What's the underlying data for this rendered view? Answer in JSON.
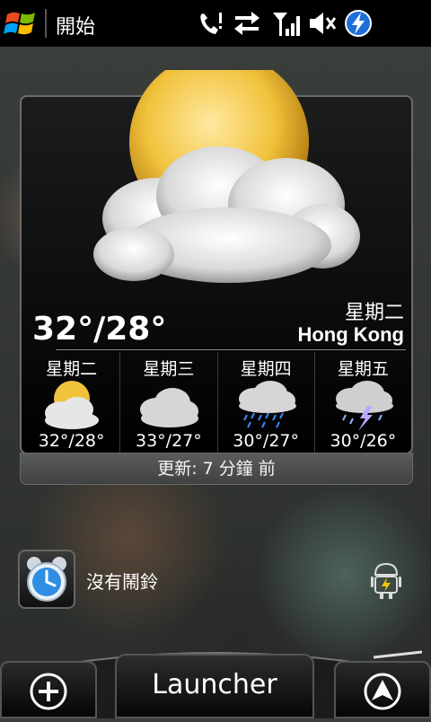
{
  "status_bar": {
    "title": "開始",
    "icons": [
      "windows-start-icon",
      "missed-call-icon",
      "data-transfer-icon",
      "signal-icon",
      "speaker-muted-icon",
      "battery-charging-icon"
    ]
  },
  "weather": {
    "current_temp": "32°/28°",
    "current_day": "星期二",
    "city": "Hong Kong",
    "current_icon": "partly-cloudy-sun-icon",
    "forecast": [
      {
        "day": "星期二",
        "temp": "32°/28°",
        "icon": "partly-cloudy-sun-icon"
      },
      {
        "day": "星期三",
        "temp": "33°/27°",
        "icon": "cloudy-icon"
      },
      {
        "day": "星期四",
        "temp": "30°/27°",
        "icon": "rain-icon"
      },
      {
        "day": "星期五",
        "temp": "30°/26°",
        "icon": "thunderstorm-icon"
      }
    ],
    "updated": "更新: 7 分鐘 前"
  },
  "alarm": {
    "label": "沒有鬧鈴",
    "icon": "alarm-clock-icon"
  },
  "bottom_bar": {
    "add_icon": "plus-icon",
    "launcher_label": "Launcher",
    "up_icon": "up-arrow-icon"
  },
  "colors": {
    "accent_blue": "#1e6fd9",
    "android_green": "#a4c639"
  }
}
